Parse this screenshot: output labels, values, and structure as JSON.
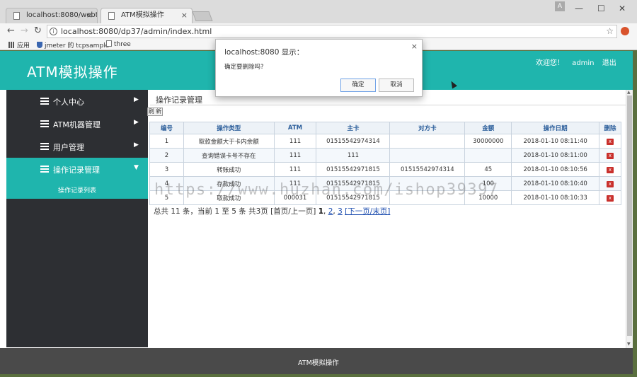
{
  "browser": {
    "tabs": [
      {
        "title": "localhost:8080/webto",
        "active": false
      },
      {
        "title": "ATM模拟操作",
        "active": true
      }
    ],
    "url": "localhost:8080/dp37/admin/index.html",
    "bookmarks": [
      "应用",
      "jmeter 的 tcpsample",
      "three"
    ],
    "profile_initial": "A"
  },
  "header": {
    "logo": "ATM模拟操作",
    "welcome": "欢迎您！",
    "username": "admin",
    "logout": "退出"
  },
  "sidebar": {
    "items": [
      {
        "label": "个人中心",
        "arrow": "▶"
      },
      {
        "label": "ATM机器管理",
        "arrow": "▶"
      },
      {
        "label": "用户管理",
        "arrow": "▶"
      },
      {
        "label": "操作记录管理",
        "arrow": "▼"
      }
    ],
    "submenu": "操作记录列表"
  },
  "content": {
    "title": "操作记录管理",
    "refresh_label": "刷 新",
    "columns": [
      "编号",
      "操作类型",
      "ATM",
      "主卡",
      "对方卡",
      "金额",
      "操作日期",
      "删除"
    ],
    "rows": [
      [
        "1",
        "取款金额大于卡内余额",
        "111",
        "01515542974314",
        "",
        "30000000",
        "2018-01-10 08:11:40"
      ],
      [
        "2",
        "查询错误卡号不存在",
        "111",
        "111",
        "",
        "",
        "2018-01-10 08:11:00"
      ],
      [
        "3",
        "转账成功",
        "111",
        "01515542971815",
        "01515542974314",
        "45",
        "2018-01-10 08:10:56"
      ],
      [
        "4",
        "存款成功",
        "111",
        "01515542971815",
        "",
        "100",
        "2018-01-10 08:10:40"
      ],
      [
        "5",
        "取款成功",
        "000031",
        "01515542971815",
        "",
        "10000",
        "2018-01-10 08:10:33"
      ]
    ],
    "delete_icon": "x"
  },
  "pager": {
    "summary": "总共 11 条，当前 1 至 5 条 共3页",
    "prev": "[首页/上一页]",
    "current": "1",
    "page2": "2",
    "page3": "3",
    "next": "[下一页/末页]"
  },
  "watermark": "https://www.huzhan.com/ishop39397",
  "footer": "ATM模拟操作",
  "dialog": {
    "title": "localhost:8080 显示：",
    "message": "确定要删除吗?",
    "ok": "确定",
    "cancel": "取消"
  }
}
